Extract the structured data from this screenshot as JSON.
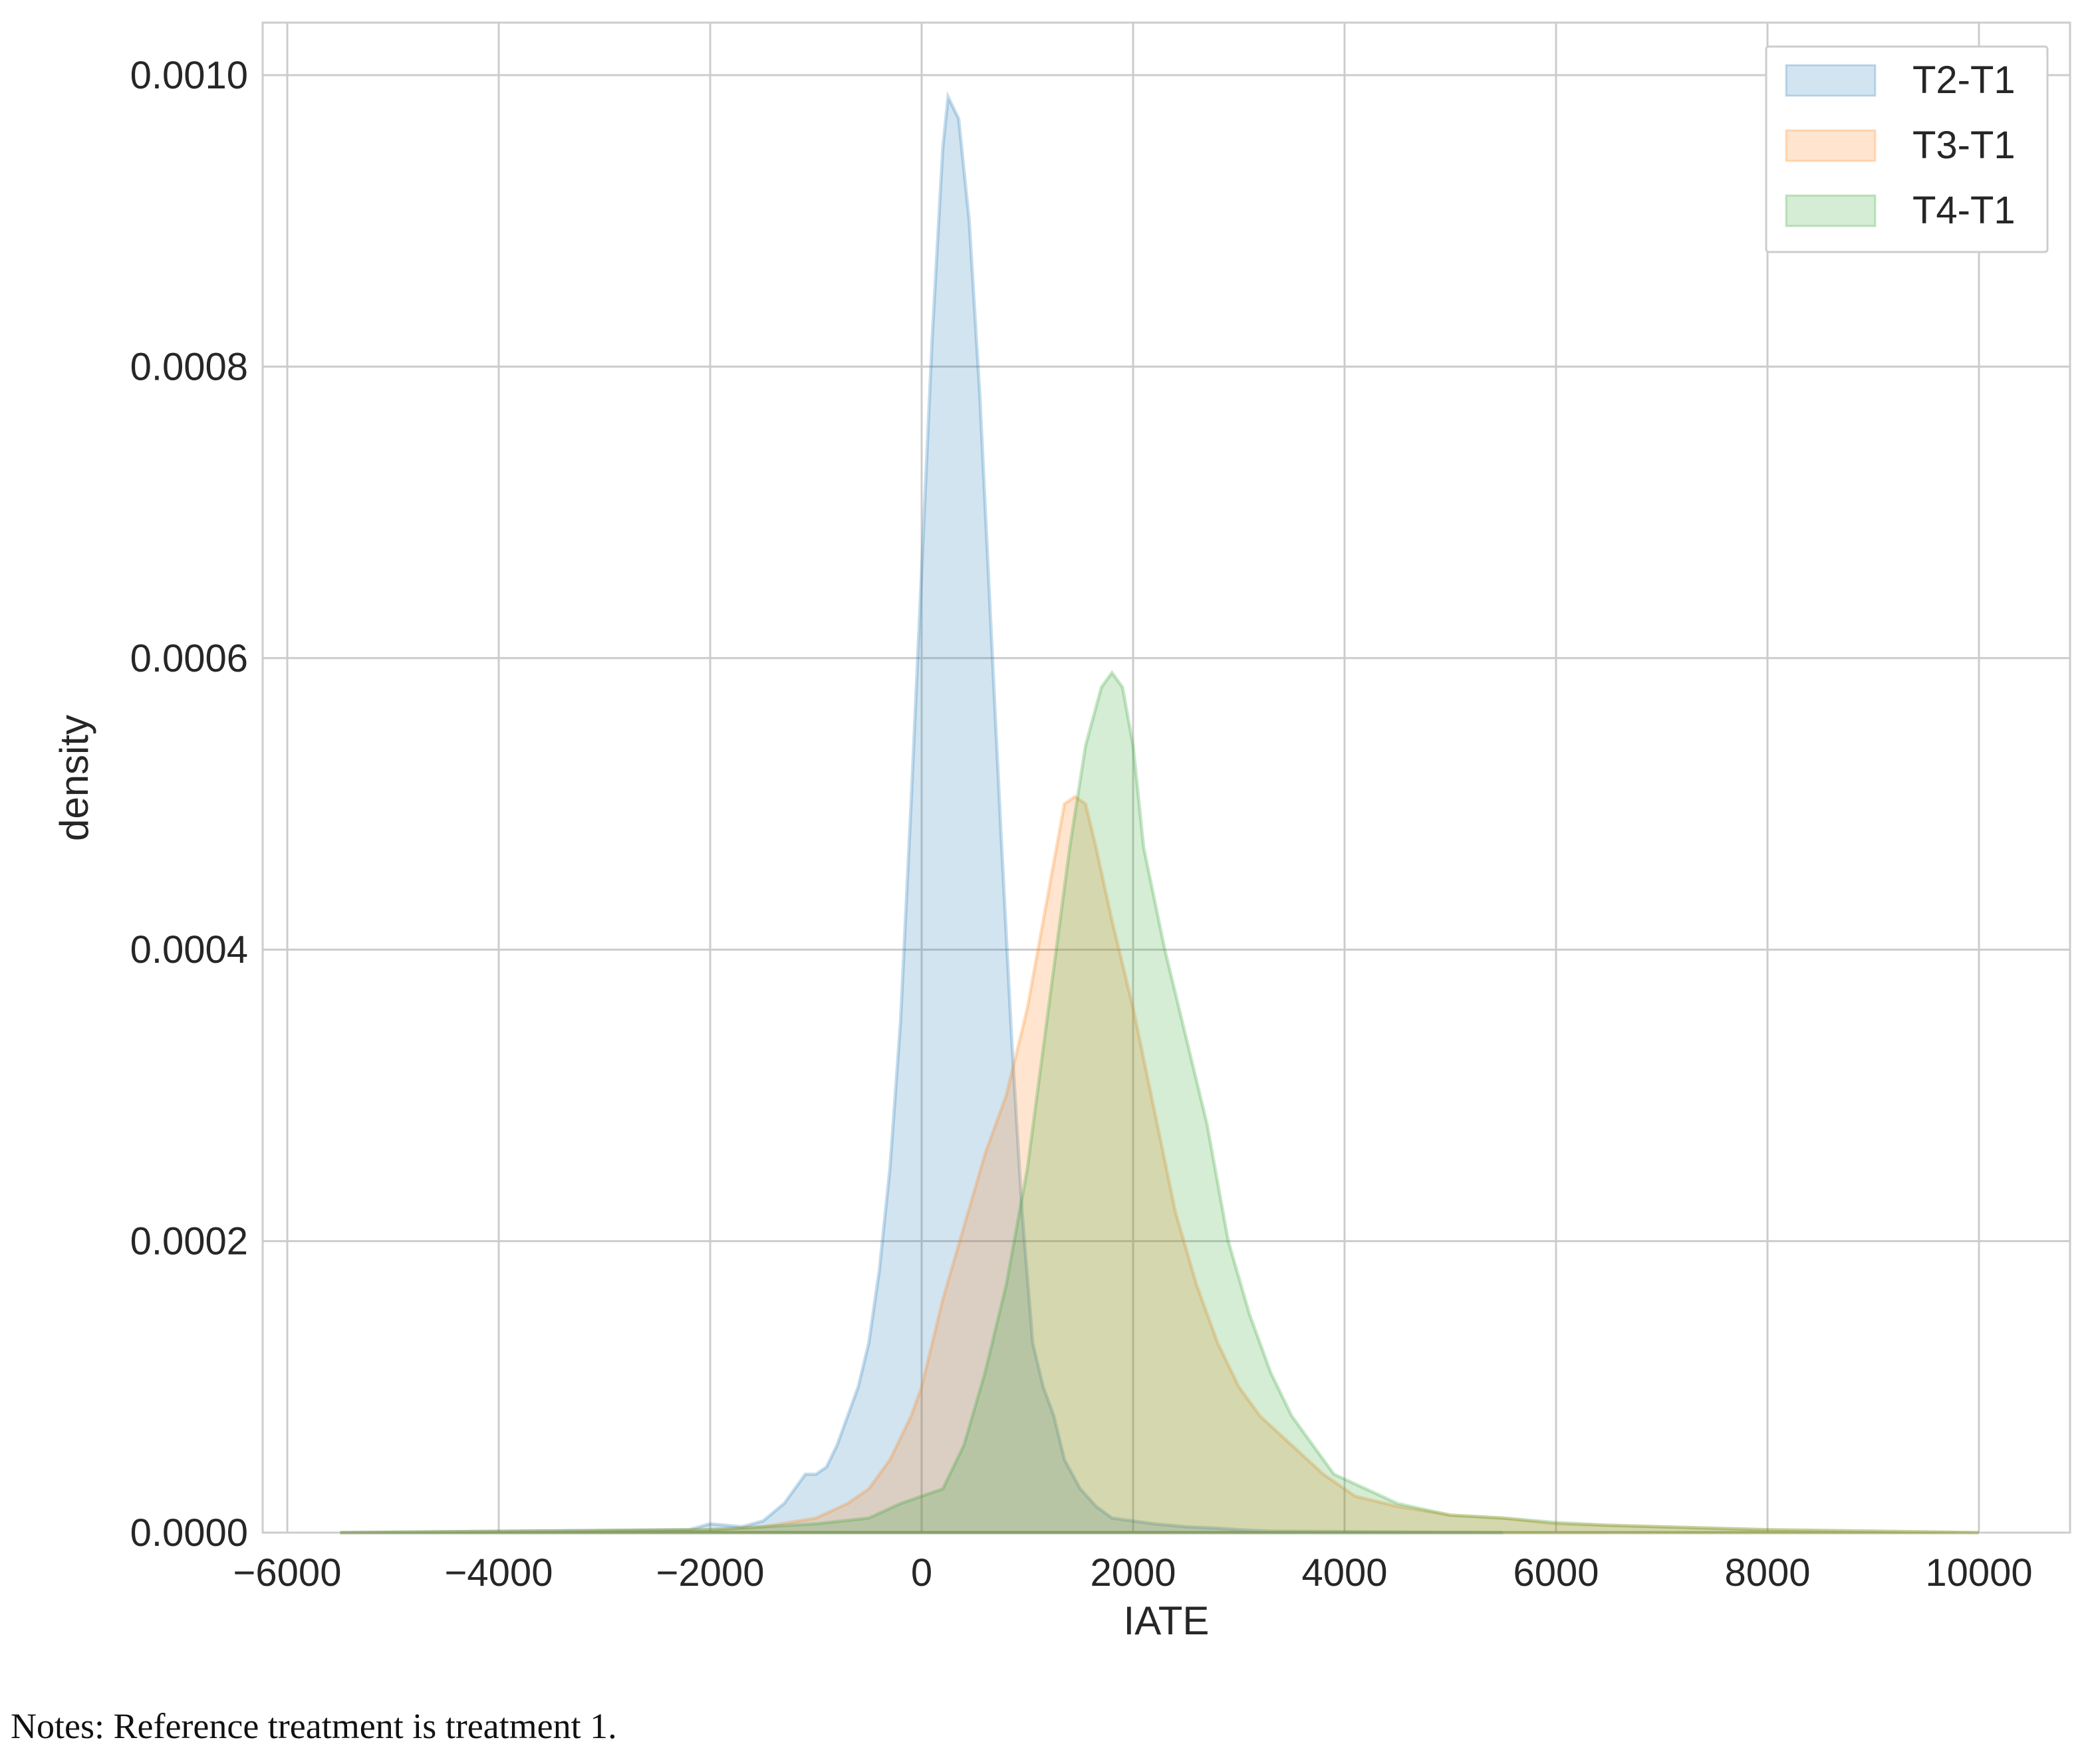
{
  "chart_data": {
    "type": "area",
    "title": "",
    "xlabel": "IATE",
    "ylabel": "density",
    "xlim": [
      -6300,
      10450
    ],
    "ylim": [
      0,
      0.00104
    ],
    "xticks": [
      -6000,
      -4000,
      -2000,
      0,
      2000,
      4000,
      6000,
      8000,
      10000
    ],
    "xtick_labels": [
      "−6000",
      "−4000",
      "−2000",
      "0",
      "2000",
      "4000",
      "6000",
      "8000",
      "10000"
    ],
    "yticks": [
      0,
      0.0002,
      0.0004,
      0.0006,
      0.0008,
      0.001
    ],
    "ytick_labels": [
      "0.0000",
      "0.0002",
      "0.0004",
      "0.0006",
      "0.0008",
      "0.0010"
    ],
    "grid": true,
    "legend_position": "top-right",
    "series": [
      {
        "name": "T2-T1",
        "color": "#1f77b4",
        "x": [
          -5500,
          -2200,
          -2000,
          -1700,
          -1500,
          -1300,
          -1200,
          -1100,
          -1000,
          -900,
          -800,
          -700,
          -600,
          -500,
          -400,
          -300,
          -200,
          -100,
          0,
          100,
          200,
          250,
          350,
          450,
          550,
          650,
          750,
          850,
          950,
          1050,
          1150,
          1250,
          1350,
          1500,
          1650,
          1800,
          2000,
          2200,
          2500,
          2800,
          3000,
          3300,
          5500
        ],
        "y": [
          0,
          2e-06,
          6e-06,
          4e-06,
          8e-06,
          2e-05,
          3e-05,
          4e-05,
          4e-05,
          4.5e-05,
          6e-05,
          8e-05,
          0.0001,
          0.00013,
          0.00018,
          0.00025,
          0.00035,
          0.0005,
          0.00066,
          0.00082,
          0.00095,
          0.000985,
          0.00097,
          0.0009,
          0.00078,
          0.00063,
          0.00048,
          0.00034,
          0.00022,
          0.00013,
          0.0001,
          8e-05,
          5e-05,
          3e-05,
          1.8e-05,
          1e-05,
          8e-06,
          6e-06,
          4e-06,
          3e-06,
          2e-06,
          1e-06,
          0
        ]
      },
      {
        "name": "T3-T1",
        "color": "#ff7f0e",
        "x": [
          -5500,
          -2000,
          -1500,
          -1000,
          -700,
          -500,
          -300,
          -100,
          0,
          200,
          400,
          600,
          800,
          1000,
          1200,
          1350,
          1450,
          1550,
          1650,
          1800,
          2000,
          2200,
          2400,
          2600,
          2800,
          3000,
          3200,
          3500,
          3800,
          4100,
          4500,
          5000,
          5500,
          6000,
          6500,
          7000,
          8000,
          9000,
          10000
        ],
        "y": [
          0,
          2e-06,
          4e-06,
          1e-05,
          2e-05,
          3e-05,
          5e-05,
          8e-05,
          0.0001,
          0.00016,
          0.00021,
          0.00026,
          0.0003,
          0.00036,
          0.00044,
          0.0005,
          0.000505,
          0.0005,
          0.00047,
          0.00042,
          0.00036,
          0.00029,
          0.00022,
          0.00017,
          0.00013,
          0.0001,
          8e-05,
          6e-05,
          4e-05,
          2.5e-05,
          1.8e-05,
          1.2e-05,
          1e-05,
          6e-06,
          5e-06,
          4e-06,
          2e-06,
          1e-06,
          0
        ]
      },
      {
        "name": "T4-T1",
        "color": "#2ca02c",
        "x": [
          -5500,
          -2000,
          -1000,
          -500,
          -200,
          0,
          200,
          400,
          600,
          800,
          1000,
          1200,
          1400,
          1550,
          1700,
          1800,
          1900,
          2000,
          2100,
          2300,
          2500,
          2700,
          2900,
          3100,
          3300,
          3500,
          3700,
          3900,
          4200,
          4500,
          5000,
          5500,
          6000,
          6500,
          7000,
          8000,
          9000,
          10000
        ],
        "y": [
          0,
          2e-06,
          6e-06,
          1e-05,
          2e-05,
          2.5e-05,
          3e-05,
          6e-05,
          0.00011,
          0.00017,
          0.00025,
          0.00036,
          0.00047,
          0.00054,
          0.00058,
          0.00059,
          0.00058,
          0.00054,
          0.00047,
          0.0004,
          0.00034,
          0.00028,
          0.0002,
          0.00015,
          0.00011,
          8e-05,
          6e-05,
          4e-05,
          3e-05,
          2e-05,
          1.2e-05,
          1e-05,
          7e-06,
          5e-06,
          4e-06,
          2e-06,
          1e-06,
          0
        ]
      }
    ]
  },
  "caption": "Notes: Reference treatment is treatment 1."
}
